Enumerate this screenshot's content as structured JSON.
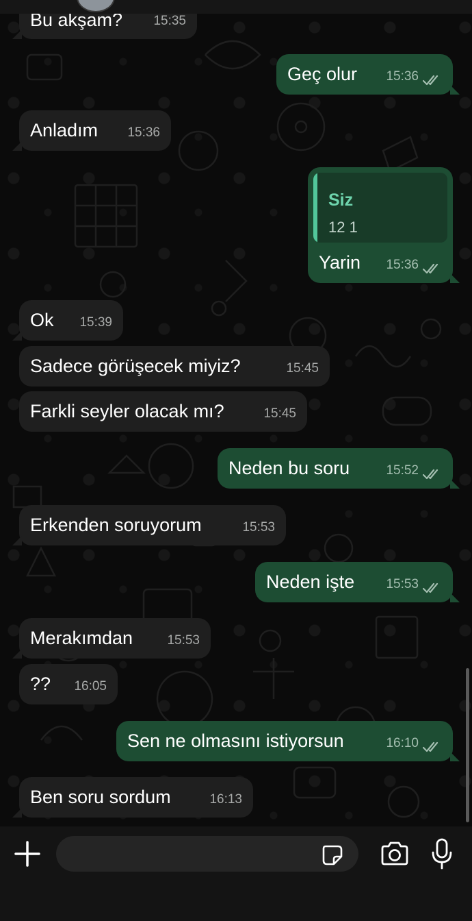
{
  "messages": [
    {
      "dir": "in",
      "text": "Bu akşam?",
      "time": "15:35"
    },
    {
      "dir": "out",
      "text": "Geç olur",
      "time": "15:36"
    },
    {
      "dir": "in",
      "text": "Anladım",
      "time": "15:36"
    },
    {
      "dir": "out",
      "text": "Yarin",
      "time": "15:36",
      "quote": {
        "name": "Siz",
        "text": "12 1"
      }
    },
    {
      "dir": "in",
      "text": "Ok",
      "time": "15:39"
    },
    {
      "dir": "in",
      "text": "Sadece görüşecek miyiz?",
      "time": "15:45"
    },
    {
      "dir": "in",
      "text": "Farkli seyler olacak mı?",
      "time": "15:45"
    },
    {
      "dir": "out",
      "text": "Neden bu soru",
      "time": "15:52"
    },
    {
      "dir": "in",
      "text": "Erkenden soruyorum",
      "time": "15:53"
    },
    {
      "dir": "out",
      "text": "Neden işte",
      "time": "15:53"
    },
    {
      "dir": "in",
      "text": "Merakımdan",
      "time": "15:53"
    },
    {
      "dir": "in",
      "text": "??",
      "time": "16:05"
    },
    {
      "dir": "out",
      "text": "Sen ne olmasını istiyorsun",
      "time": "16:10"
    },
    {
      "dir": "in",
      "text": "Ben soru sordum",
      "time": "16:13"
    }
  ],
  "composer": {
    "placeholder": ""
  },
  "icons": {
    "attach": "plus-icon",
    "sticker": "sticker-icon",
    "camera": "camera-icon",
    "mic": "microphone-icon",
    "read": "double-check-icon"
  },
  "colors": {
    "incoming_bubble": "#1f1f1f",
    "outgoing_bubble": "#1d4d33",
    "quote_accent": "#52c79b",
    "background": "#0b0b0b"
  }
}
